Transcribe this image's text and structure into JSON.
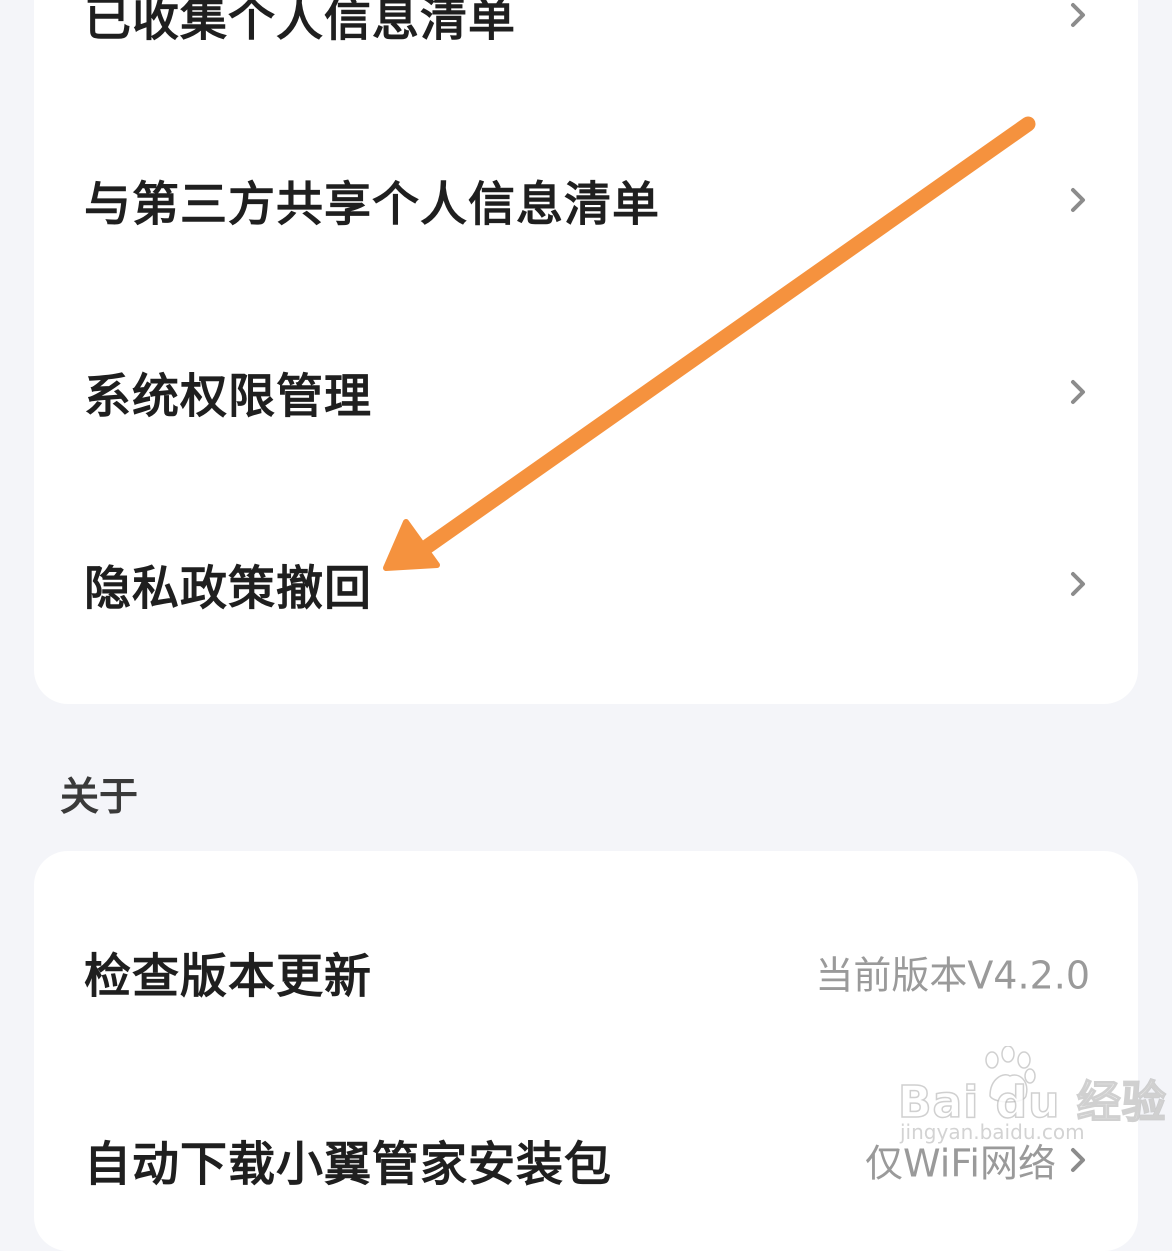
{
  "privacy_card": {
    "items": [
      {
        "label": "已收集个人信息清单"
      },
      {
        "label": "与第三方共享个人信息清单"
      },
      {
        "label": "系统权限管理"
      },
      {
        "label": "隐私政策撤回"
      }
    ]
  },
  "about_section": {
    "title": "关于",
    "items": [
      {
        "label": "检查版本更新",
        "value": "当前版本V4.2.0"
      },
      {
        "label": "自动下载小翼管家安装包",
        "value": "仅WiFi网络"
      }
    ]
  },
  "annotation": {
    "arrow_color": "#f5923e",
    "arrow_target": "隐私政策撤回"
  },
  "watermark": {
    "logo": "Bai du 经验",
    "url": "jingyan.baidu.com"
  }
}
